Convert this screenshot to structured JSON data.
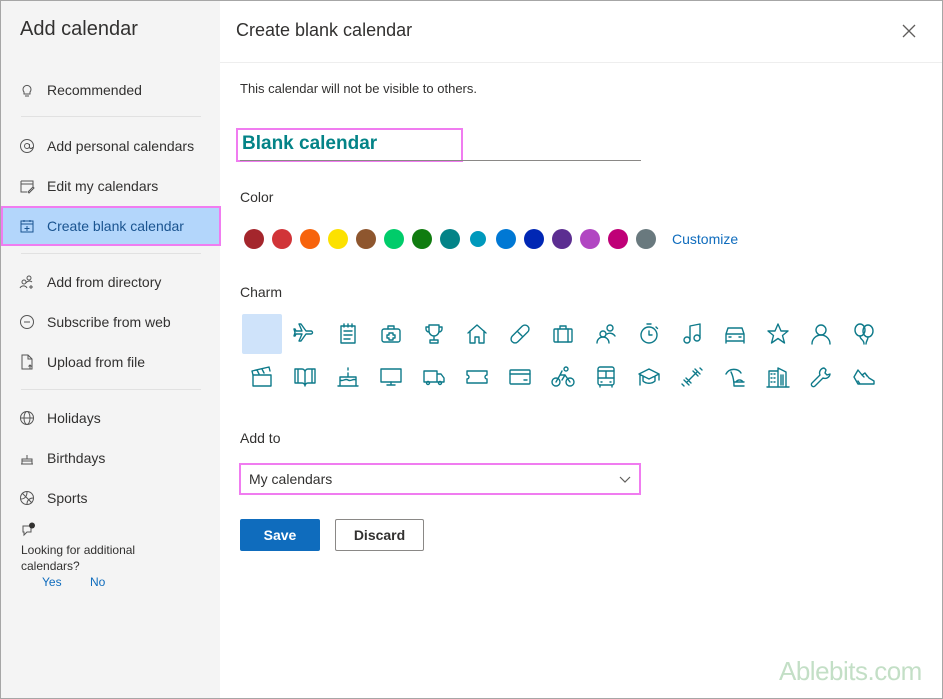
{
  "sidebar": {
    "title": "Add calendar",
    "items": [
      {
        "label": "Recommended",
        "icon": "lightbulb-icon"
      },
      {
        "label": "Add personal calendars",
        "icon": "at-icon"
      },
      {
        "label": "Edit my calendars",
        "icon": "edit-calendar-icon"
      },
      {
        "label": "Create blank calendar",
        "icon": "calendar-add-icon",
        "active": true
      },
      {
        "label": "Add from directory",
        "icon": "people-add-icon"
      },
      {
        "label": "Subscribe from web",
        "icon": "link-circle-icon"
      },
      {
        "label": "Upload from file",
        "icon": "file-upload-icon"
      },
      {
        "label": "Holidays",
        "icon": "globe-icon"
      },
      {
        "label": "Birthdays",
        "icon": "cake-icon"
      },
      {
        "label": "Sports",
        "icon": "ball-icon"
      }
    ],
    "feedback": {
      "question": "Looking for additional calendars?",
      "yes": "Yes",
      "no": "No"
    }
  },
  "main": {
    "title": "Create blank calendar",
    "note": "This calendar will not be visible to others.",
    "name_value": "Blank calendar",
    "color_label": "Color",
    "colors": [
      "#a4262c",
      "#d13438",
      "#f7630c",
      "#fce100",
      "#8e562e",
      "#00cc6a",
      "#107c10",
      "#038387",
      "#0099bc",
      "#0078d4",
      "#0027b4",
      "#5c2e91",
      "#b146c2",
      "#bf0077",
      "#69797e"
    ],
    "selected_color": "#0099bc",
    "customize_label": "Customize",
    "charm_label": "Charm",
    "charms": [
      "none",
      "airplane",
      "notepad",
      "first-aid",
      "trophy",
      "home",
      "bandage",
      "briefcase",
      "people",
      "stopwatch",
      "music-note",
      "car",
      "star",
      "person",
      "balloons",
      "clapperboard",
      "book",
      "cake",
      "monitor",
      "truck",
      "ticket",
      "credit-card",
      "bicycle",
      "bus",
      "graduation-cap",
      "dumbbell",
      "beach",
      "building",
      "wrench",
      "sneaker"
    ],
    "selected_charm": "none",
    "add_to_label": "Add to",
    "add_to_value": "My calendars",
    "save_label": "Save",
    "discard_label": "Discard"
  },
  "watermark": "Ablebits.com"
}
